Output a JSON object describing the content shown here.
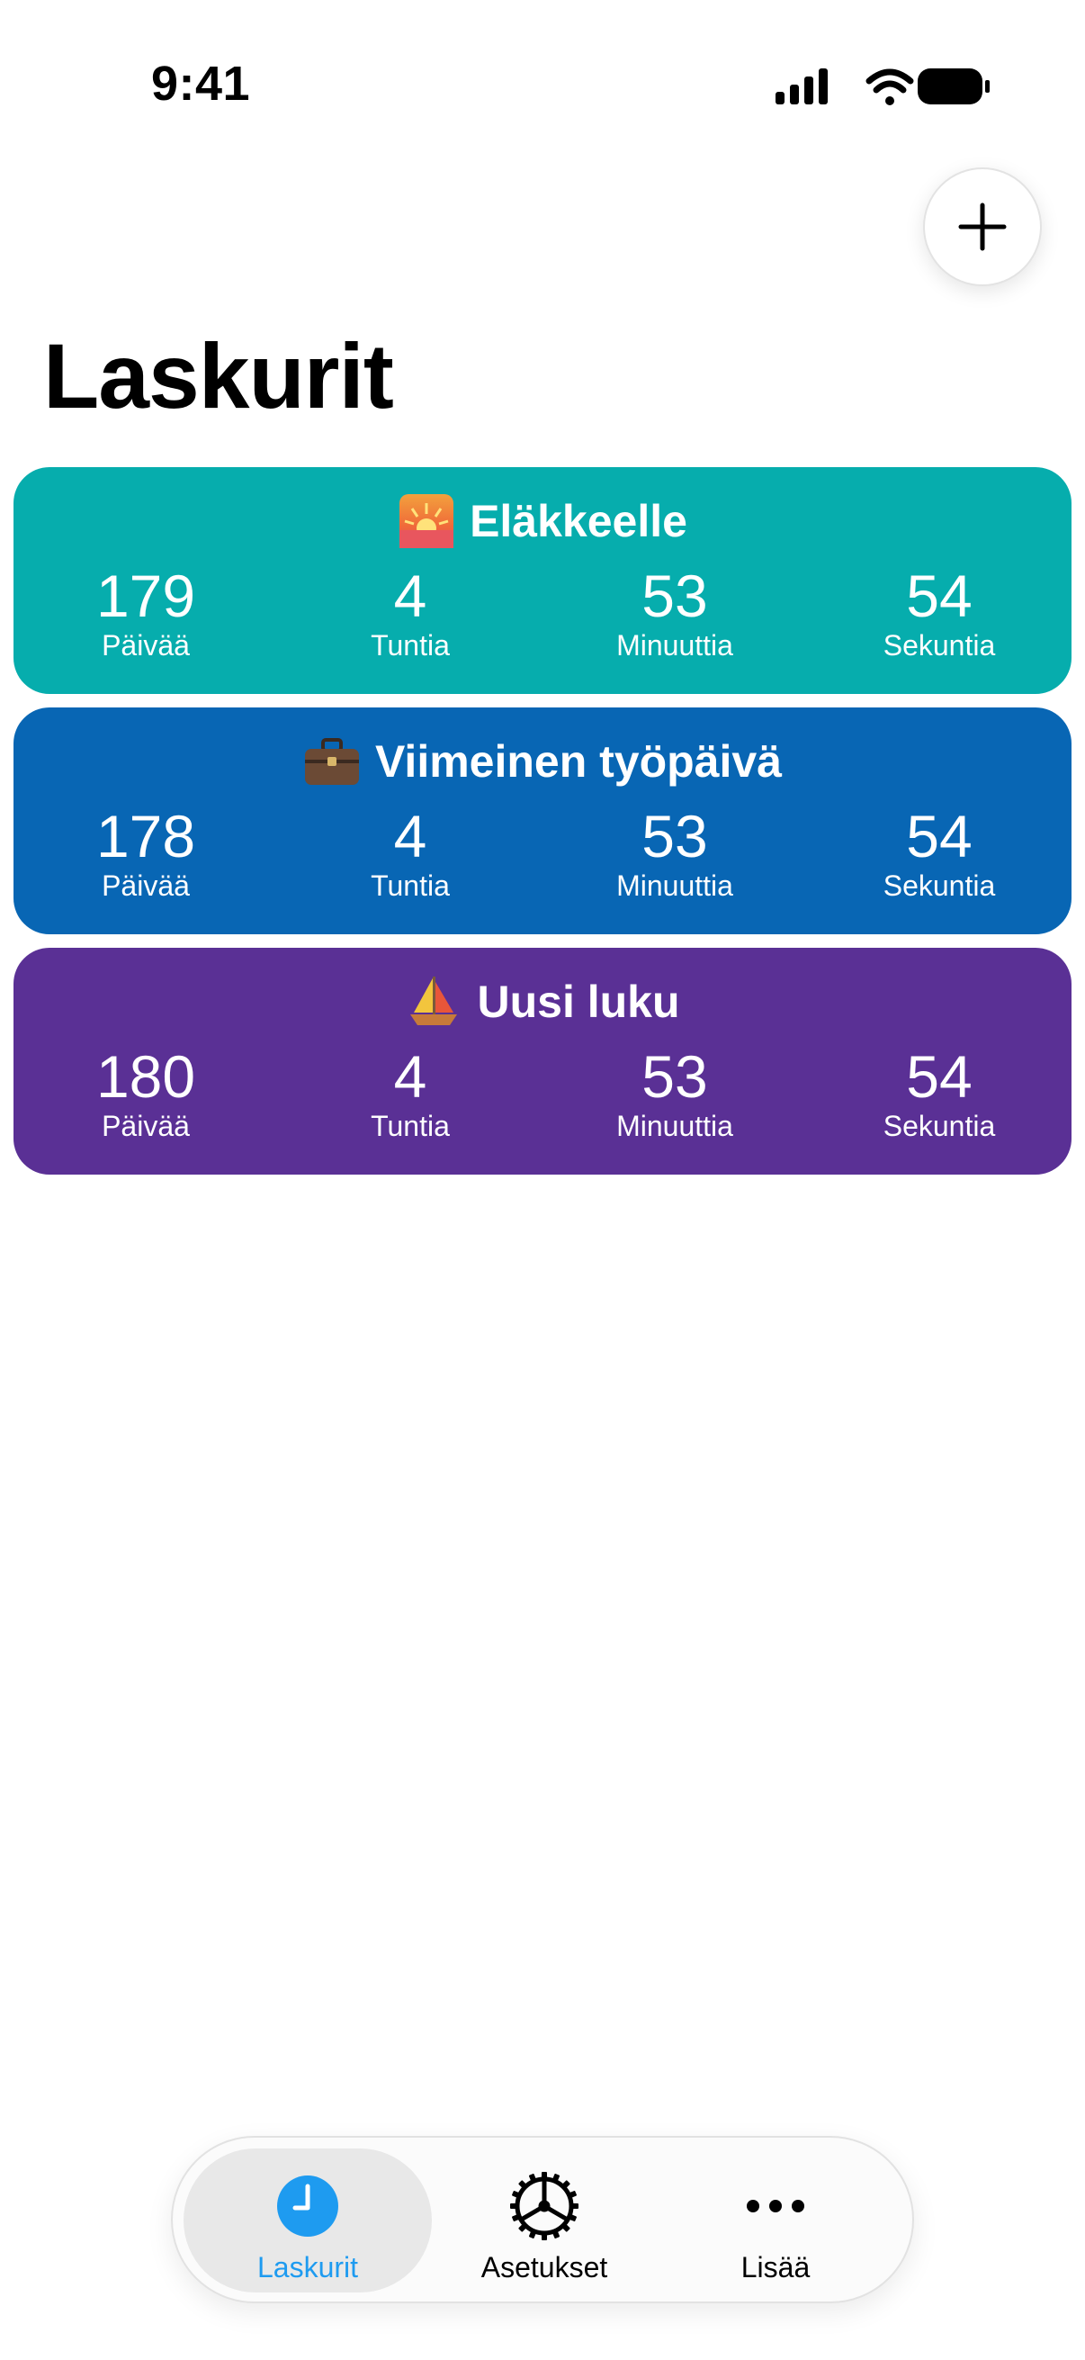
{
  "status_bar": {
    "time": "9:41"
  },
  "header": {
    "title": "Laskurit",
    "add_icon": "plus-icon"
  },
  "counters": [
    {
      "title": "Eläkkeelle",
      "emoji": "sunrise",
      "color": "#06ADAD",
      "units": [
        {
          "value": "179",
          "label": "Päivää"
        },
        {
          "value": "4",
          "label": "Tuntia"
        },
        {
          "value": "53",
          "label": "Minuuttia"
        },
        {
          "value": "54",
          "label": "Sekuntia"
        }
      ]
    },
    {
      "title": "Viimeinen työpäivä",
      "emoji": "briefcase",
      "color": "#0866B4",
      "units": [
        {
          "value": "178",
          "label": "Päivää"
        },
        {
          "value": "4",
          "label": "Tuntia"
        },
        {
          "value": "53",
          "label": "Minuuttia"
        },
        {
          "value": "54",
          "label": "Sekuntia"
        }
      ]
    },
    {
      "title": "Uusi luku",
      "emoji": "sailboat",
      "color": "#5A3095",
      "units": [
        {
          "value": "180",
          "label": "Päivää"
        },
        {
          "value": "4",
          "label": "Tuntia"
        },
        {
          "value": "53",
          "label": "Minuuttia"
        },
        {
          "value": "54",
          "label": "Sekuntia"
        }
      ]
    }
  ],
  "tab_bar": {
    "accent_color": "#1E9BF0",
    "tabs": [
      {
        "label": "Laskurit",
        "icon": "clock-icon",
        "active": true
      },
      {
        "label": "Asetukset",
        "icon": "gear-icon",
        "active": false
      },
      {
        "label": "Lisää",
        "icon": "more-icon",
        "active": false
      }
    ]
  }
}
